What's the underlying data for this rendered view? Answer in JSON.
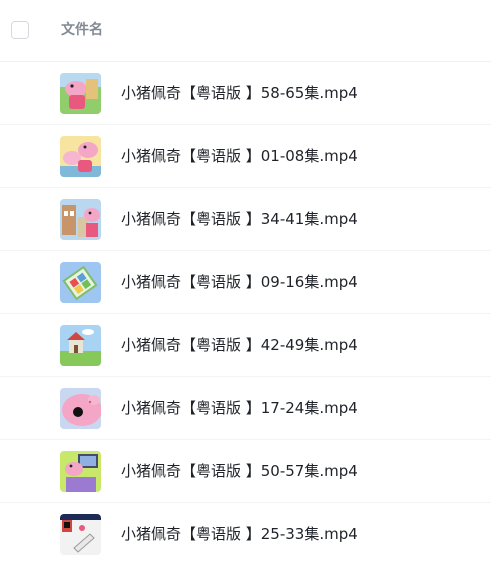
{
  "header": {
    "column_title": "文件名"
  },
  "files": [
    {
      "name": "小猪佩奇【粤语版 】58-65集.mp4",
      "thumbnail_icon": "video-thumbnail-icon"
    },
    {
      "name": "小猪佩奇【粤语版 】01-08集.mp4",
      "thumbnail_icon": "video-thumbnail-icon"
    },
    {
      "name": "小猪佩奇【粤语版 】34-41集.mp4",
      "thumbnail_icon": "video-thumbnail-icon"
    },
    {
      "name": "小猪佩奇【粤语版 】09-16集.mp4",
      "thumbnail_icon": "video-thumbnail-icon"
    },
    {
      "name": "小猪佩奇【粤语版 】42-49集.mp4",
      "thumbnail_icon": "video-thumbnail-icon"
    },
    {
      "name": "小猪佩奇【粤语版 】17-24集.mp4",
      "thumbnail_icon": "video-thumbnail-icon"
    },
    {
      "name": "小猪佩奇【粤语版 】50-57集.mp4",
      "thumbnail_icon": "video-thumbnail-icon"
    },
    {
      "name": "小猪佩奇【粤语版 】25-33集.mp4",
      "thumbnail_icon": "video-thumbnail-icon"
    }
  ]
}
